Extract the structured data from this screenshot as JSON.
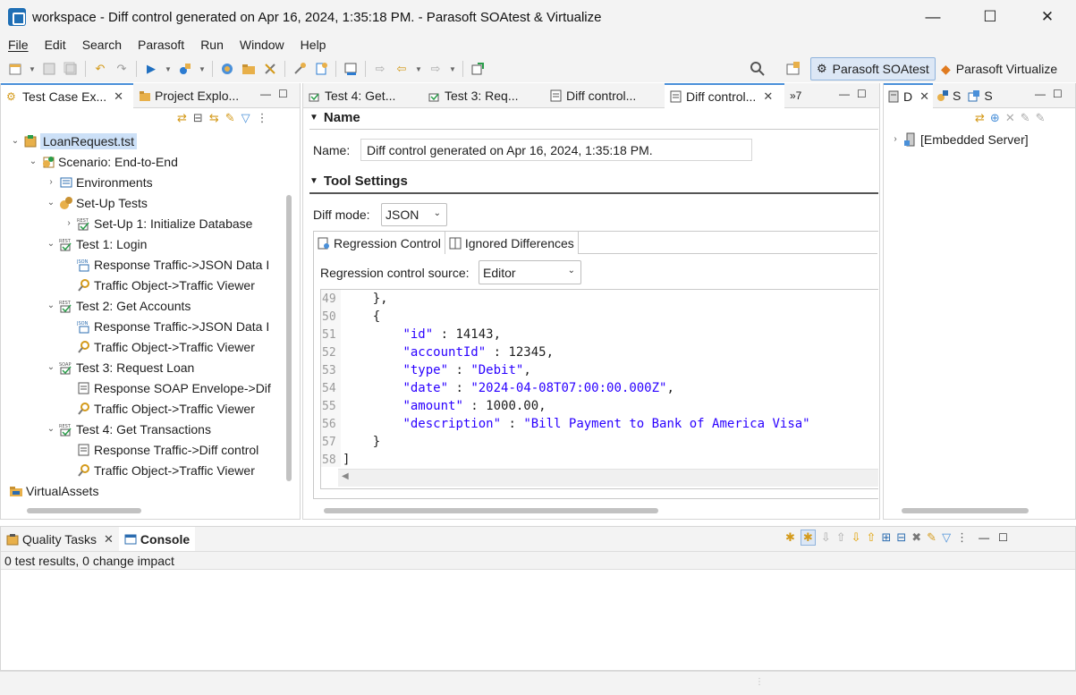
{
  "window": {
    "title": "workspace - Diff control generated on Apr 16, 2024, 1:35:18 PM. - Parasoft SOAtest & Virtualize",
    "minimize": "—",
    "maximize": "☐",
    "close": "✕"
  },
  "menu": [
    "File",
    "Edit",
    "Search",
    "Parasoft",
    "Run",
    "Window",
    "Help"
  ],
  "perspectives": {
    "soatest": "Parasoft SOAtest",
    "virtualize": "Parasoft Virtualize"
  },
  "left_tabs": {
    "test_case_explorer": "Test Case Ex...",
    "project_explorer": "Project Explo..."
  },
  "tree": {
    "root": "LoanRequest.tst",
    "scenario": "Scenario: End-to-End",
    "environments": "Environments",
    "setup_tests": "Set-Up Tests",
    "setup1": "Set-Up 1: Initialize Database",
    "test1": "Test 1: Login",
    "test1_c1": "Response Traffic->JSON Data I",
    "test1_c2": "Traffic Object->Traffic Viewer",
    "test2": "Test 2: Get Accounts",
    "test2_c1": "Response Traffic->JSON Data I",
    "test2_c2": "Traffic Object->Traffic Viewer",
    "test3": "Test 3: Request Loan",
    "test3_c1": "Response SOAP Envelope->Dif",
    "test3_c2": "Traffic Object->Traffic Viewer",
    "test4": "Test 4: Get Transactions",
    "test4_c1": "Response Traffic->Diff control",
    "test4_c2": "Traffic Object->Traffic Viewer",
    "virtual_assets": "VirtualAssets"
  },
  "editor_tabs": {
    "t1": "Test 4: Get...",
    "t2": "Test 3: Req...",
    "t3": "Diff control...",
    "t4": "Diff control...",
    "overflow": "»7"
  },
  "editor": {
    "name_section": "Name",
    "name_label": "Name:",
    "name_value": "Diff control generated on Apr 16, 2024, 1:35:18 PM.",
    "tool_settings_section": "Tool Settings",
    "diff_mode_label": "Diff mode:",
    "diff_mode_value": "JSON",
    "subtab_regression": "Regression Control",
    "subtab_ignored": "Ignored Differences",
    "source_label": "Regression control source:",
    "source_value": "Editor"
  },
  "code": {
    "line_numbers": [
      "49",
      "50",
      "51",
      "52",
      "53",
      "54",
      "55",
      "56",
      "57",
      "58"
    ],
    "l49": "    },",
    "l50": "    {",
    "l51_key": "\"id\"",
    "l51_rest": " : 14143,",
    "l52_key": "\"accountId\"",
    "l52_rest": " : 12345,",
    "l53_key": "\"type\"",
    "l53_sep": " : ",
    "l53_val": "\"Debit\"",
    "l53_end": ",",
    "l54_key": "\"date\"",
    "l54_sep": " : ",
    "l54_val": "\"2024-04-08T07:00:00.000Z\"",
    "l54_end": ",",
    "l55_key": "\"amount\"",
    "l55_rest": " : 1000.00,",
    "l56_key": "\"description\"",
    "l56_sep": " : ",
    "l56_val": "\"Bill Payment to Bank of America Visa\"",
    "l57": "    }",
    "l58": "]"
  },
  "right_panel": {
    "tab1": "D",
    "tab2": "S",
    "tab3": "S",
    "embedded_server": "[Embedded Server]"
  },
  "bottom": {
    "quality_tasks": "Quality Tasks",
    "console": "Console",
    "status": "0 test results, 0 change impact"
  }
}
